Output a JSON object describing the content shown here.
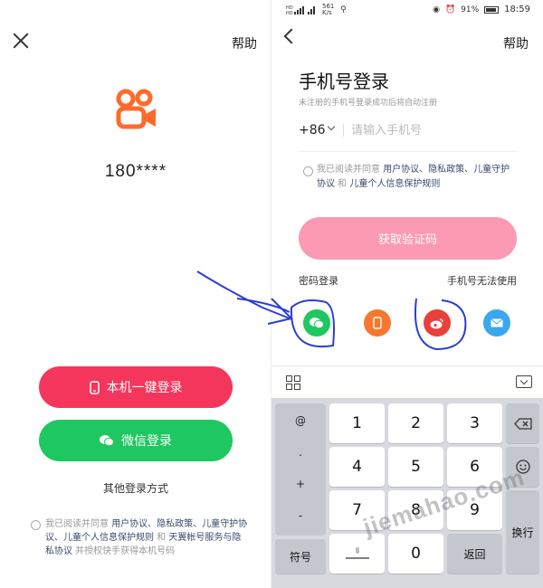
{
  "left": {
    "help": "帮助",
    "masked_phone": "180****",
    "quick_login": "本机一键登录",
    "wechat_login": "微信登录",
    "other_login": "其他登录方式",
    "agreement": {
      "prefix": "我已阅读并同意 ",
      "links": "用户协议、隐私政策、儿童守护协议、儿童个人信息保护规则",
      "mid": " 和 ",
      "link2": "天翼帐号服务与隐私协议",
      "suffix": " 并授权快手获得本机号码"
    }
  },
  "right": {
    "status": {
      "net_speed": "561 K/s",
      "battery": "91%",
      "time": "18:59"
    },
    "help": "帮助",
    "title": "手机号登录",
    "subtitle": "未注册的手机号登录成功后将自动注册",
    "country_code": "+86",
    "phone_placeholder": "请输入手机号",
    "agreement": {
      "prefix": "我已阅读并同意 ",
      "links": "用户协议、隐私政策、儿童守护协议",
      "mid": " 和 ",
      "link2": "儿童个人信息保护规则"
    },
    "get_code": "获取验证码",
    "password_login": "密码登录",
    "phone_unavailable": "手机号无法使用"
  },
  "keyboard": {
    "symbols": [
      "@",
      ".",
      "+",
      "-"
    ],
    "digits": [
      "1",
      "2",
      "3",
      "4",
      "5",
      "6",
      "7",
      "8",
      "9",
      "0"
    ],
    "symbol_key": "符号",
    "return_key": "返回",
    "switch_key": "换行"
  },
  "watermark": "jiemahao.com",
  "colors": {
    "brand_orange": "#ff6a2c",
    "quick_login_red": "#f5365c",
    "wechat_green": "#1ec760",
    "get_code_pink": "#fb9ab2",
    "annotation_blue": "#2b3fd0"
  }
}
